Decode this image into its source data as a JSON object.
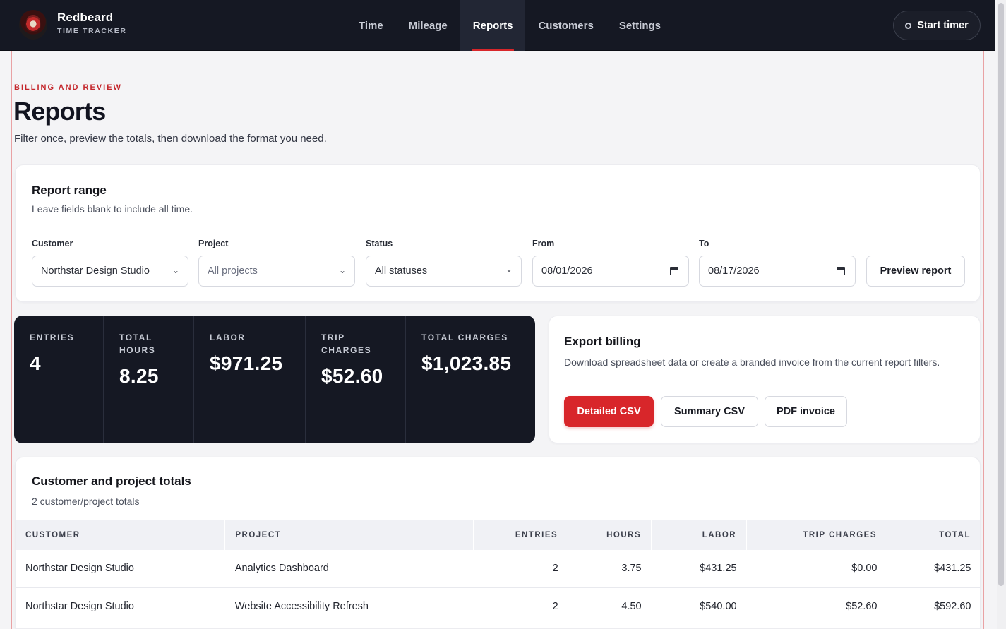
{
  "brand": {
    "name": "Redbeard",
    "subtitle": "TIME TRACKER"
  },
  "nav": {
    "items": [
      {
        "label": "Time",
        "active": false
      },
      {
        "label": "Mileage",
        "active": false
      },
      {
        "label": "Reports",
        "active": true
      },
      {
        "label": "Customers",
        "active": false
      },
      {
        "label": "Settings",
        "active": false
      }
    ],
    "timer_label": "Start timer"
  },
  "header": {
    "eyebrow": "BILLING AND REVIEW",
    "title": "Reports",
    "subtitle": "Filter once, preview the totals, then download the format you need."
  },
  "range": {
    "title": "Report range",
    "description": "Leave fields blank to include all time.",
    "customer": {
      "label": "Customer",
      "value": "Northstar Design Studio"
    },
    "project": {
      "label": "Project",
      "value": "All projects"
    },
    "status": {
      "label": "Status",
      "value": "All statuses"
    },
    "from": {
      "label": "From",
      "value": "08/01/2026"
    },
    "to": {
      "label": "To",
      "value": "08/17/2026"
    },
    "preview_label": "Preview report"
  },
  "stats": [
    {
      "label": "ENTRIES",
      "value": "4"
    },
    {
      "label": "TOTAL HOURS",
      "value": "8.25"
    },
    {
      "label": "LABOR",
      "value": "$971.25"
    },
    {
      "label": "TRIP CHARGES",
      "value": "$52.60"
    },
    {
      "label": "TOTAL CHARGES",
      "value": "$1,023.85"
    }
  ],
  "export": {
    "title": "Export billing",
    "description": "Download spreadsheet data or create a branded invoice from the current report filters.",
    "detailed_csv": "Detailed CSV",
    "summary_csv": "Summary CSV",
    "pdf_invoice": "PDF invoice"
  },
  "totals": {
    "title": "Customer and project totals",
    "count": "2 customer/project totals",
    "columns": [
      "CUSTOMER",
      "PROJECT",
      "ENTRIES",
      "HOURS",
      "LABOR",
      "TRIP CHARGES",
      "TOTAL"
    ],
    "rows": [
      [
        "Northstar Design Studio",
        "Analytics Dashboard",
        "2",
        "3.75",
        "$431.25",
        "$0.00",
        "$431.25"
      ],
      [
        "Northstar Design Studio",
        "Website Accessibility Refresh",
        "2",
        "4.50",
        "$540.00",
        "$52.60",
        "$592.60"
      ]
    ]
  },
  "colors": {
    "accent": "#d8262a",
    "nav_bg": "#151823",
    "page_bg": "#f4f4f6"
  },
  "icons": {
    "logo": "redbeard-logo",
    "timer": "circle-icon",
    "date": "calendar-icon",
    "select": "chevron-down-icon"
  }
}
